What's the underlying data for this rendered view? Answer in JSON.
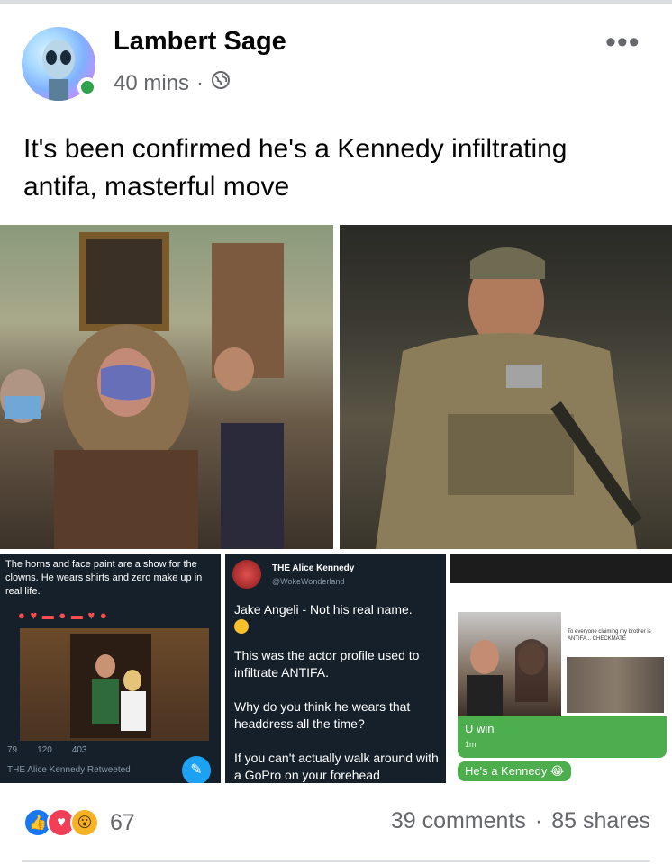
{
  "post": {
    "author": "Lambert Sage",
    "time": "40 mins",
    "separator": "·",
    "text": "It's been confirmed he's a Kennedy infiltrating antifa, masterful move"
  },
  "media": {
    "left_tweet": {
      "caption": "The horns and face paint are a show for the clowns. He wears shirts and zero make up in real life.",
      "stats": [
        "79",
        "120",
        "403"
      ],
      "retweet": "THE Alice Kennedy Retweeted"
    },
    "mid_tweet": {
      "name": "THE Alice Kennedy",
      "handle": "@WokeWonderland",
      "lines": [
        "Jake Angeli - Not his real name.",
        "This was the actor profile used to infiltrate ANTIFA.",
        "Why do you think he wears that headdress all the time?",
        "If you can't actually walk around with a GoPro on your forehead"
      ]
    },
    "right_chat": {
      "note": "To everyone claiming my brother is ANTIFA... CHECKMATE",
      "bubble1": "U win",
      "bubble1_time": "1m",
      "bubble2": "He's a Kennedy"
    }
  },
  "footer": {
    "reaction_count": "67",
    "comments": "39 comments",
    "dot": "·",
    "shares": "85 shares"
  },
  "icons": [
    "globe-icon",
    "more-icon",
    "like-icon",
    "love-icon",
    "wow-icon"
  ],
  "colors": {
    "like": "#1877f2",
    "love": "#f33e58",
    "wow": "#f7b125",
    "presence": "#31a24c"
  }
}
